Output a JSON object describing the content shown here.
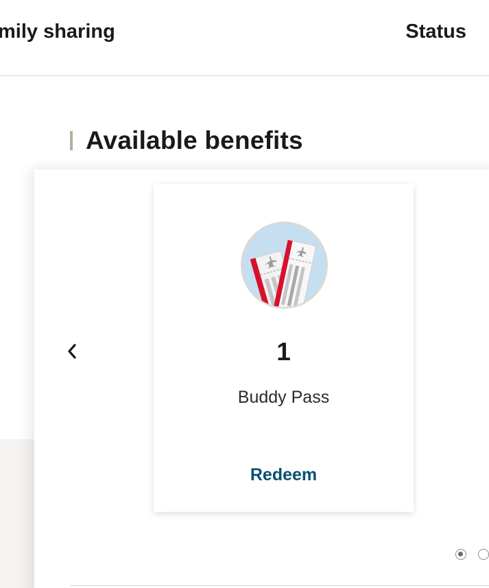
{
  "nav": {
    "family_sharing_label": "mily sharing",
    "status_label": "Status"
  },
  "section": {
    "heading": "Available benefits"
  },
  "carousel": {
    "prev_icon": "chevron-left-icon",
    "page_count": 2,
    "active_page": 1
  },
  "benefit": {
    "icon": "tickets-icon",
    "count": "1",
    "name": "Buddy Pass",
    "action_label": "Redeem"
  },
  "colors": {
    "heading_bar": "#b8ada1",
    "link": "#0b4f73",
    "icon_bg": "#c5dff0",
    "ticket_red": "#d8102a"
  }
}
